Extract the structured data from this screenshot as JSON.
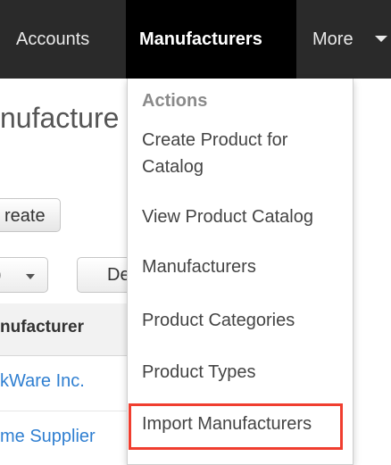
{
  "nav": {
    "items": [
      {
        "label": "Accounts"
      },
      {
        "label": "Manufacturers"
      },
      {
        "label": "More"
      }
    ]
  },
  "page": {
    "title_partial": "nufacture",
    "create_button_label": "reate",
    "select_value": ")",
    "button_de_label": "De",
    "table_header": "nufacturer",
    "rows": [
      "kWare Inc.",
      "me Supplier"
    ]
  },
  "dropdown": {
    "header": "Actions",
    "items": [
      "Create Product for Catalog",
      "View Product Catalog",
      "Manufacturers",
      "Product Categories",
      "Product Types",
      "Import Manufacturers"
    ],
    "highlight_color": "#f03e2f"
  },
  "icons": {
    "more_caret": "chevron-down-icon",
    "select_arrow": "chevron-down-icon",
    "sort": "sort-icon"
  }
}
